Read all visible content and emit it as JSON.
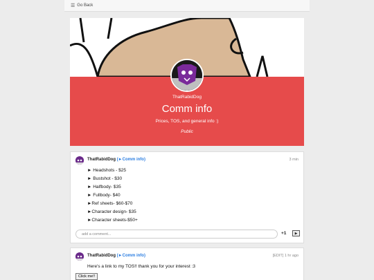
{
  "topbar": {
    "back_label": "Go Back"
  },
  "header": {
    "author": "ThatRabidDog",
    "title": "Comm info",
    "description": "Prices, TOS, and general info :)",
    "visibility": "Public",
    "accent_color": "#e64b4b"
  },
  "posts": [
    {
      "author": "ThatRabidDog",
      "tag": "(►Comm info)",
      "time": "3 min",
      "lines": [
        "► Headshots - $25",
        "► Bustshot - $30",
        "► Halfbody- $35",
        "► Fullbody- $40",
        "►Ref sheets- $60-$70",
        "►Character design- $35",
        "►Character sheets-$50+"
      ],
      "comment_placeholder": "add a comment...",
      "plus_label": "+1",
      "play_label": "▶"
    },
    {
      "author": "ThatRabidDog",
      "tag": "(►Comm info)",
      "time": "[EDIT] 1 hr ago",
      "text": "Here's a link to my TOS!! thank you for your interest :3",
      "button_label": "Click me!!"
    }
  ]
}
